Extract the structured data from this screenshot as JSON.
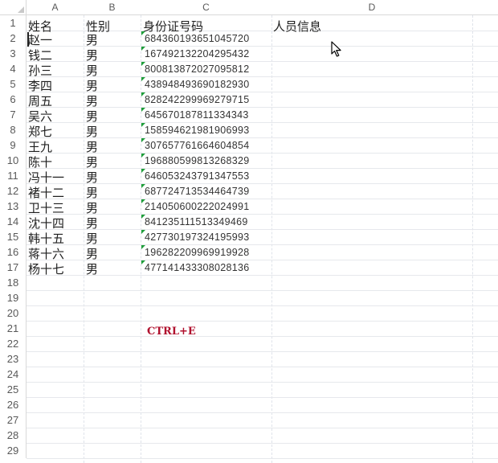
{
  "columns": [
    "A",
    "B",
    "C",
    "D"
  ],
  "row_numbers": [
    "1",
    "2",
    "3",
    "4",
    "5",
    "6",
    "7",
    "8",
    "9",
    "10",
    "11",
    "12",
    "13",
    "14",
    "15",
    "16",
    "17",
    "18",
    "19",
    "20",
    "21",
    "22",
    "23",
    "24",
    "25",
    "26",
    "27",
    "28",
    "29"
  ],
  "headers": {
    "name": "姓名",
    "gender": "性别",
    "id_number": "身份证号码",
    "person_info": "人员信息"
  },
  "rows": [
    {
      "name": "赵一",
      "gender": "男",
      "id": "684360193651045720"
    },
    {
      "name": "钱二",
      "gender": "男",
      "id": "167492132204295432"
    },
    {
      "name": "孙三",
      "gender": "男",
      "id": "800813872027095812"
    },
    {
      "name": "李四",
      "gender": "男",
      "id": "438948493690182930"
    },
    {
      "name": "周五",
      "gender": "男",
      "id": "828242299969279715"
    },
    {
      "name": "吴六",
      "gender": "男",
      "id": "645670187811334343"
    },
    {
      "name": "郑七",
      "gender": "男",
      "id": "158594621981906993"
    },
    {
      "name": "王九",
      "gender": "男",
      "id": "307657761664604854"
    },
    {
      "name": "陈十",
      "gender": "男",
      "id": "196880599813268329"
    },
    {
      "name": "冯十一",
      "gender": "男",
      "id": "646053243791347553"
    },
    {
      "name": "褚十二",
      "gender": "男",
      "id": "687724713534464739"
    },
    {
      "name": "卫十三",
      "gender": "男",
      "id": "214050600222024991"
    },
    {
      "name": "沈十四",
      "gender": "男",
      "id": "841235111513349469"
    },
    {
      "name": "韩十五",
      "gender": "男",
      "id": "427730197324195993"
    },
    {
      "name": "蒋十六",
      "gender": "男",
      "id": "196282209969919928"
    },
    {
      "name": "杨十七",
      "gender": "男",
      "id": "477141433308028136"
    }
  ],
  "shortcut_text": "CTRL+E",
  "colors": {
    "shortcut": "#b0112e",
    "number_flag": "#1e9e3a",
    "gridline": "#e6e8ec"
  },
  "icons": [
    "mouse-pointer-icon"
  ]
}
